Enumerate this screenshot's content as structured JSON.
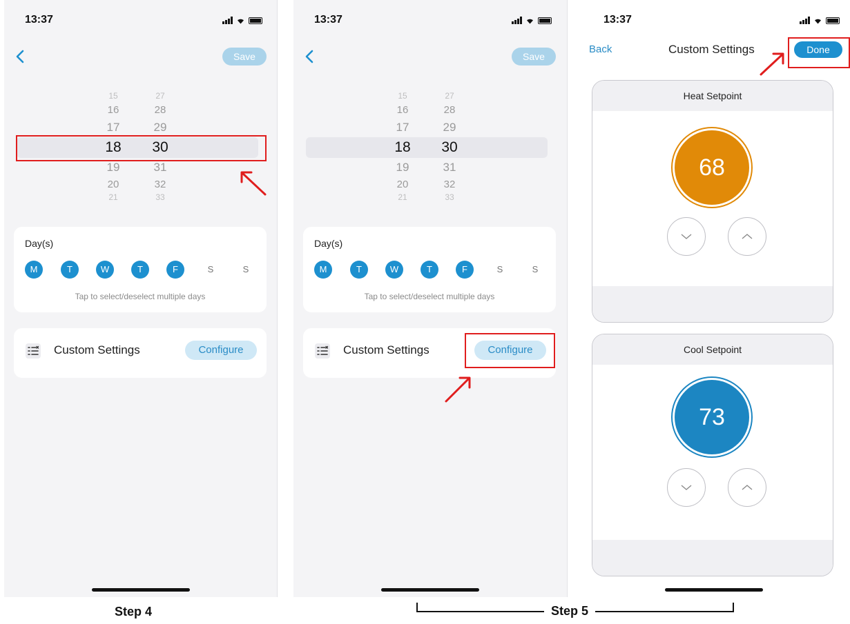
{
  "status": {
    "time": "13:37"
  },
  "schedule": {
    "save_label": "Save",
    "picker": {
      "hours_above": [
        "15",
        "16",
        "17"
      ],
      "minutes_above": [
        "27",
        "28",
        "29"
      ],
      "selected_hour": "18",
      "selected_minute": "30",
      "hours_below": [
        "19",
        "20",
        "21"
      ],
      "minutes_below": [
        "31",
        "32",
        "33"
      ]
    },
    "days_title": "Day(s)",
    "days": [
      {
        "label": "M",
        "selected": true
      },
      {
        "label": "T",
        "selected": true
      },
      {
        "label": "W",
        "selected": true
      },
      {
        "label": "T",
        "selected": true
      },
      {
        "label": "F",
        "selected": true
      },
      {
        "label": "S",
        "selected": false
      },
      {
        "label": "S",
        "selected": false
      }
    ],
    "days_hint": "Tap to select/deselect multiple days",
    "custom_settings_label": "Custom Settings",
    "configure_label": "Configure"
  },
  "custom_settings": {
    "back_label": "Back",
    "title": "Custom Settings",
    "done_label": "Done",
    "heat": {
      "title": "Heat Setpoint",
      "value": "68"
    },
    "cool": {
      "title": "Cool Setpoint",
      "value": "73"
    }
  },
  "steps": {
    "step4": "Step 4",
    "step5": "Step 5"
  },
  "colors": {
    "accent": "#1d90cf",
    "heat": "#e18a08",
    "cool": "#1c86c2",
    "annotation": "#e01d1d"
  },
  "icons": [
    "chevron-left-icon",
    "signal-icon",
    "wifi-icon",
    "battery-icon",
    "list-settings-icon",
    "chevron-down-icon",
    "chevron-up-icon",
    "red-arrow-icon"
  ]
}
